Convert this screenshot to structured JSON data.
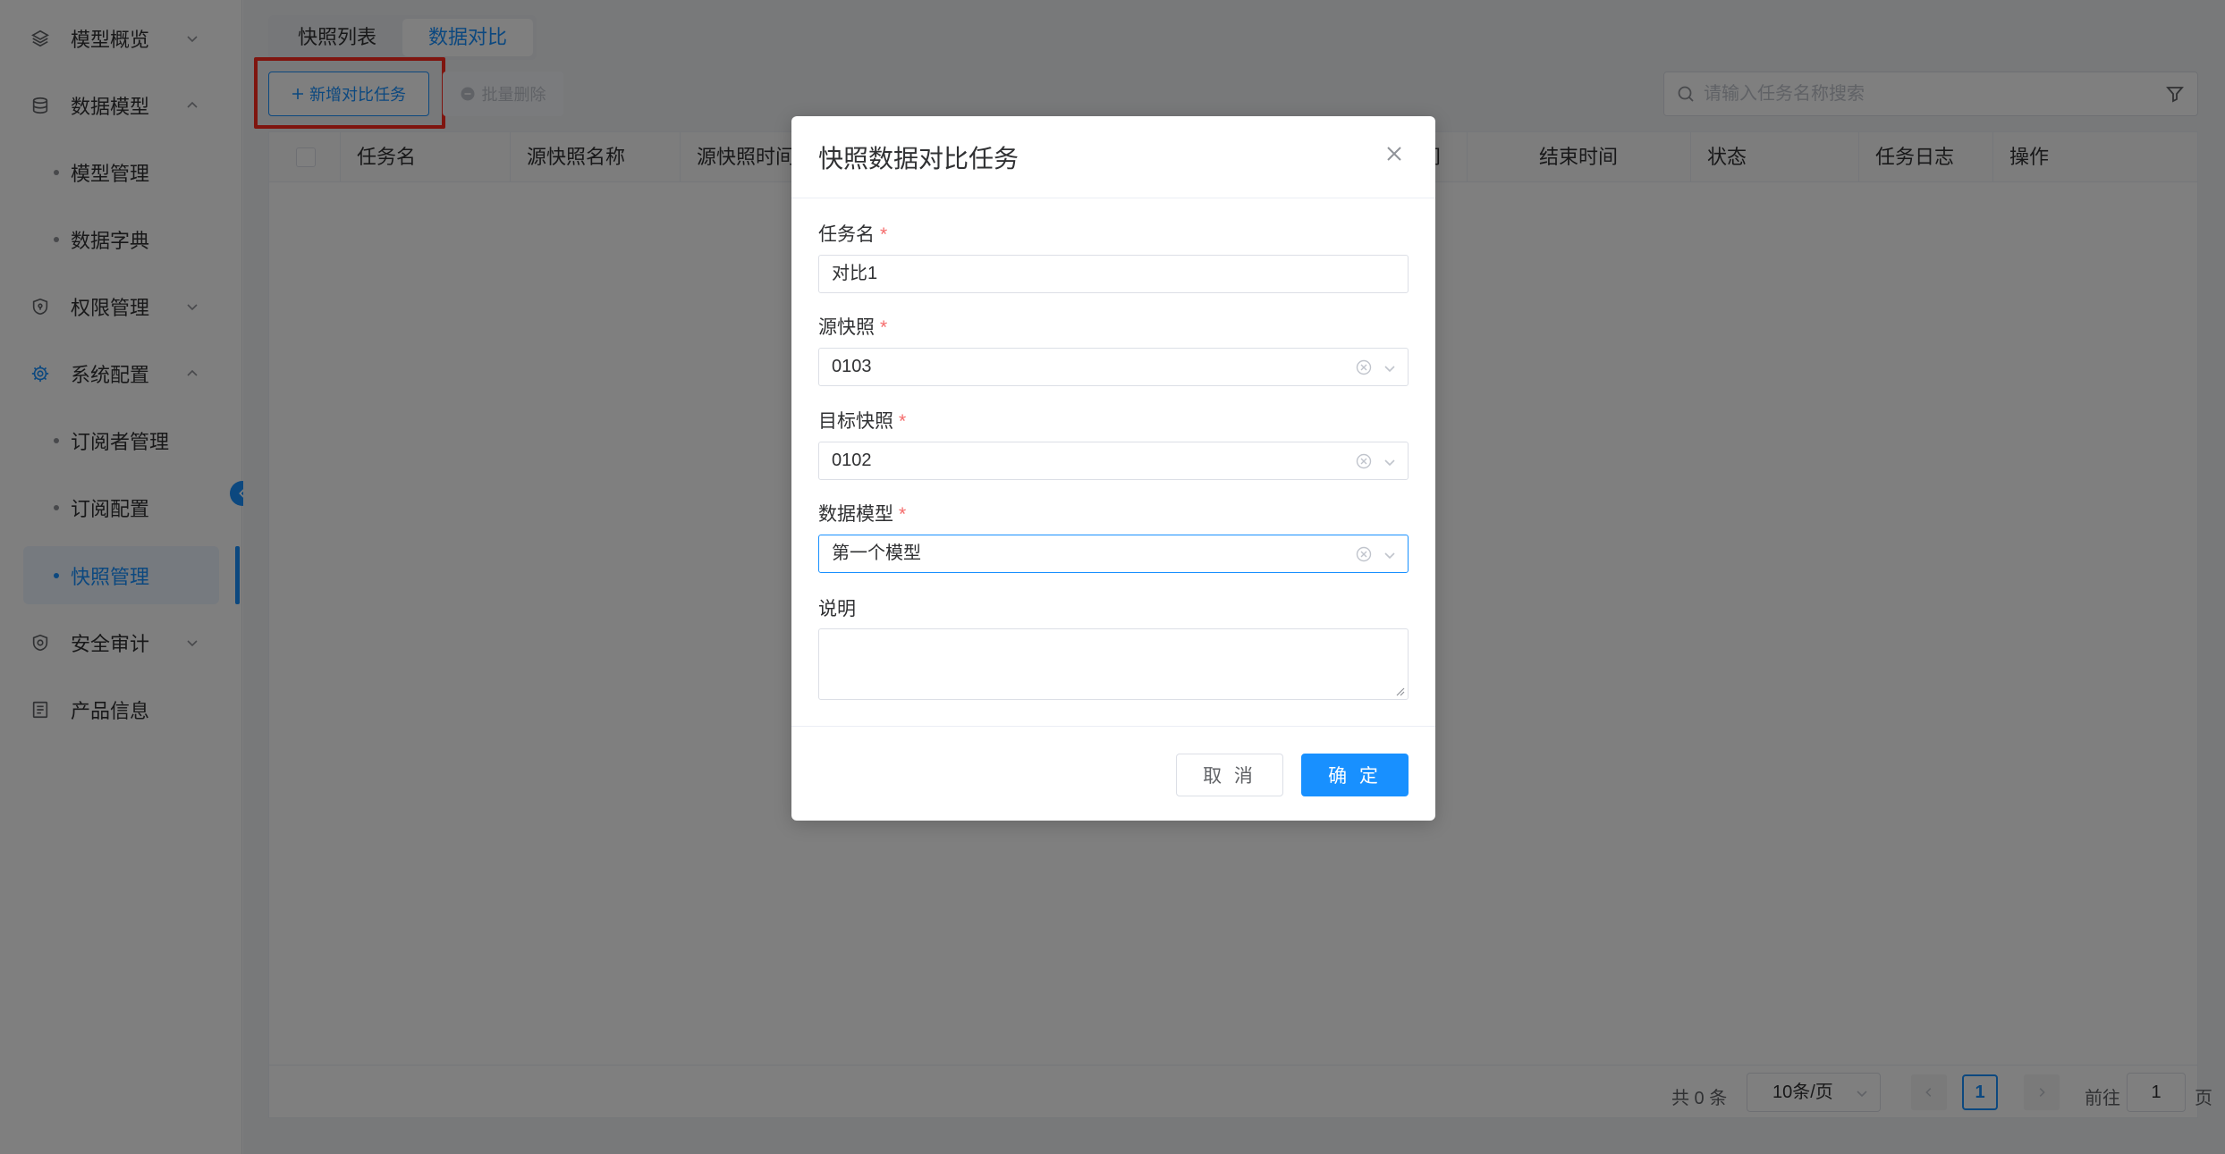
{
  "sidebar": {
    "items": [
      {
        "label": "模型概览",
        "icon": "layers-icon"
      },
      {
        "label": "数据模型",
        "icon": "database-icon"
      },
      {
        "label": "模型管理"
      },
      {
        "label": "数据字典"
      },
      {
        "label": "权限管理",
        "icon": "shield-icon"
      },
      {
        "label": "系统配置",
        "icon": "gear-icon"
      },
      {
        "label": "订阅者管理"
      },
      {
        "label": "订阅配置"
      },
      {
        "label": "快照管理"
      },
      {
        "label": "安全审计",
        "icon": "shield-check-icon"
      },
      {
        "label": "产品信息",
        "icon": "document-icon"
      }
    ],
    "active_item": "快照管理"
  },
  "tabs": [
    {
      "label": "快照列表"
    },
    {
      "label": "数据对比"
    }
  ],
  "active_tab": "数据对比",
  "toolbar": {
    "new_button": "新增对比任务",
    "batch_delete": "批量删除",
    "search_placeholder": "请输入任务名称搜索"
  },
  "table": {
    "columns": [
      "任务名",
      "源快照名称",
      "源快照时间",
      "间",
      "结束时间",
      "状态",
      "任务日志",
      "操作"
    ],
    "rows": []
  },
  "pagination": {
    "total": "共 0 条",
    "page_size": "10条/页",
    "current_page": "1",
    "goto_label": "前往",
    "goto_value": "1",
    "page_suffix": "页"
  },
  "dialog": {
    "title": "快照数据对比任务",
    "fields": {
      "task_name": {
        "label": "任务名",
        "value": "对比1",
        "required": "*"
      },
      "source_snapshot": {
        "label": "源快照",
        "value": "0103",
        "required": "*"
      },
      "target_snapshot": {
        "label": "目标快照",
        "value": "0102",
        "required": "*"
      },
      "data_model": {
        "label": "数据模型",
        "value": "第一个模型",
        "required": "*"
      },
      "description": {
        "label": "说明",
        "value": ""
      }
    },
    "cancel": "取 消",
    "confirm": "确 定"
  },
  "colors": {
    "primary": "#1890ff",
    "highlight": "#ff2a1f",
    "required": "#f56c6c"
  }
}
